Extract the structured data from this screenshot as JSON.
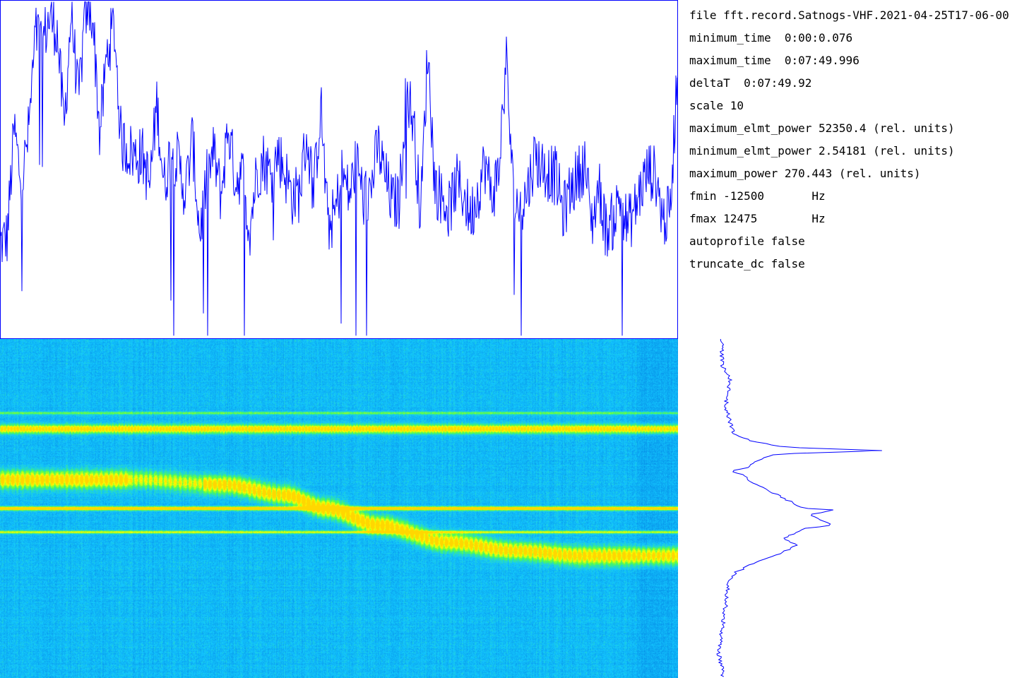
{
  "info": {
    "lines": [
      "file fft.record.Satnogs-VHF.2021-04-25T17-06-00",
      "minimum_time  0:00:0.076",
      "maximum_time  0:07:49.996",
      "deltaT  0:07:49.92",
      "scale 10",
      "maximum_elmt_power 52350.4 (rel. units)",
      "minimum_elmt_power 2.54181 (rel. units)",
      "maximum_power 270.443 (rel. units)",
      "fmin -12500       Hz",
      "fmax 12475        Hz",
      "autoprofile false",
      "truncate_dc false"
    ]
  },
  "colors": {
    "trace": "#0000ff",
    "border": "#0000ff",
    "background": "#ffffff"
  },
  "chart_data": [
    {
      "type": "line",
      "x_axis": "time",
      "y_axis": "power",
      "series": [
        {
          "values": [
            0.28,
            0.3,
            0.62,
            0.45,
            0.61,
            0.9,
            0.88,
            0.95,
            0.91,
            0.62,
            0.97,
            0.7,
            0.97,
            0.96,
            0.6,
            0.84,
            0.93,
            0.58,
            0.56,
            0.54,
            0.54,
            0.45,
            0.7,
            0.45,
            0.56,
            0.52,
            0.43,
            0.59,
            0.31,
            0.47,
            0.55,
            0.42,
            0.63,
            0.47,
            0.49,
            0.32,
            0.49,
            0.53,
            0.48,
            0.55,
            0.49,
            0.42,
            0.43,
            0.6,
            0.43,
            0.69,
            0.33,
            0.37,
            0.49,
            0.42,
            0.53,
            0.41,
            0.44,
            0.57,
            0.48,
            0.4,
            0.41,
            0.74,
            0.64,
            0.36,
            0.86,
            0.45,
            0.42,
            0.38,
            0.46,
            0.43,
            0.36,
            0.43,
            0.52,
            0.42,
            0.5,
            0.83,
            0.42,
            0.38,
            0.44,
            0.54,
            0.51,
            0.49,
            0.48,
            0.37,
            0.44,
            0.48,
            0.52,
            0.34,
            0.45,
            0.32,
            0.35,
            0.42,
            0.33,
            0.38,
            0.45,
            0.5,
            0.48,
            0.35,
            0.37,
            0.8
          ]
        }
      ]
    },
    {
      "type": "heatmap",
      "x_axis": "time",
      "y_axis": "frequency",
      "tracks": [
        {
          "kind": "constant",
          "freq": 0.265,
          "intensity": 0.85,
          "width": 0.012
        },
        {
          "kind": "constant",
          "freq": 0.5,
          "intensity": 1.0,
          "width": 0.005
        },
        {
          "kind": "constant",
          "freq": 0.57,
          "intensity": 0.55,
          "width": 0.004
        },
        {
          "kind": "constant",
          "freq": 0.218,
          "intensity": 0.35,
          "width": 0.004
        },
        {
          "kind": "doppler",
          "points": [
            [
              0.0,
              0.415
            ],
            [
              0.2,
              0.415
            ],
            [
              0.33,
              0.43
            ],
            [
              0.42,
              0.46
            ],
            [
              0.48,
              0.5
            ],
            [
              0.56,
              0.55
            ],
            [
              0.66,
              0.6
            ],
            [
              0.76,
              0.625
            ],
            [
              0.86,
              0.64
            ],
            [
              1.0,
              0.64
            ]
          ],
          "intensity": 0.9,
          "width": 0.024
        }
      ]
    },
    {
      "type": "line",
      "x_axis": "power",
      "y_axis": "frequency",
      "series": [
        {
          "values": [
            [
              0.02,
              0.08
            ],
            [
              0.045,
              0.12
            ],
            [
              0.03,
              0.2
            ],
            [
              0.045,
              0.25
            ],
            [
              0.055,
              0.28
            ],
            [
              0.1,
              0.3
            ],
            [
              0.2,
              0.32
            ],
            [
              0.5,
              0.33
            ],
            [
              0.18,
              0.34
            ],
            [
              0.12,
              0.36
            ],
            [
              0.1,
              0.38
            ],
            [
              0.05,
              0.39
            ],
            [
              0.08,
              0.4
            ],
            [
              0.1,
              0.42
            ],
            [
              0.18,
              0.46
            ],
            [
              0.26,
              0.5
            ],
            [
              0.35,
              0.505
            ],
            [
              0.28,
              0.52
            ],
            [
              0.35,
              0.55
            ],
            [
              0.26,
              0.56
            ],
            [
              0.2,
              0.59
            ],
            [
              0.24,
              0.61
            ],
            [
              0.18,
              0.64
            ],
            [
              0.12,
              0.66
            ],
            [
              0.06,
              0.69
            ],
            [
              0.04,
              0.72
            ],
            [
              0.03,
              0.79
            ],
            [
              0.02,
              0.86
            ],
            [
              0.01,
              0.93
            ],
            [
              0.02,
              0.97
            ]
          ]
        }
      ]
    }
  ]
}
